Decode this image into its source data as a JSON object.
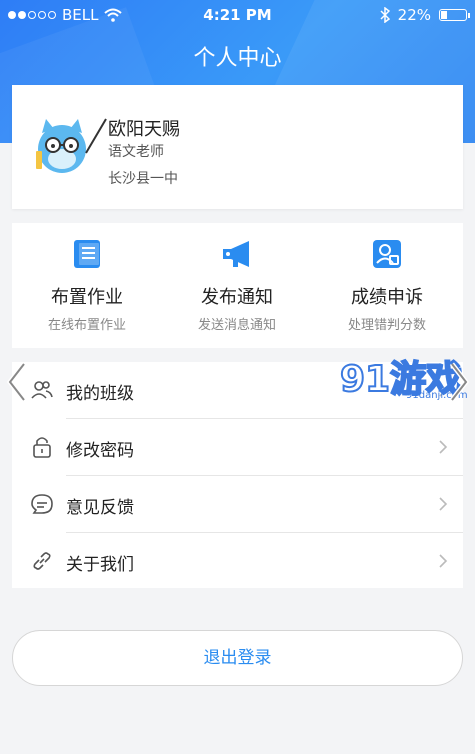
{
  "status_bar": {
    "carrier": "BELL",
    "time": "4:21 PM",
    "battery_percent": "22%",
    "battery_level": 0.22,
    "signal_bars": 2
  },
  "header": {
    "title": "个人中心"
  },
  "profile": {
    "name": "欧阳天赐",
    "role": "语文老师",
    "school": "长沙县一中"
  },
  "actions": [
    {
      "label": "布置作业",
      "sub": "在线布置作业",
      "icon": "document-icon"
    },
    {
      "label": "发布通知",
      "sub": "发送消息通知",
      "icon": "megaphone-icon"
    },
    {
      "label": "成绩申诉",
      "sub": "处理错判分数",
      "icon": "user-card-icon"
    }
  ],
  "menu": [
    {
      "label": "我的班级",
      "icon": "people-icon"
    },
    {
      "label": "修改密码",
      "icon": "lock-icon"
    },
    {
      "label": "意见反馈",
      "icon": "feedback-icon"
    },
    {
      "label": "关于我们",
      "icon": "link-icon"
    }
  ],
  "logout_label": "退出登录",
  "watermark": {
    "text": "91游戏",
    "url_text": "91danji.com"
  },
  "colors": {
    "accent": "#2a8cf0",
    "header": "#2e86f5"
  }
}
